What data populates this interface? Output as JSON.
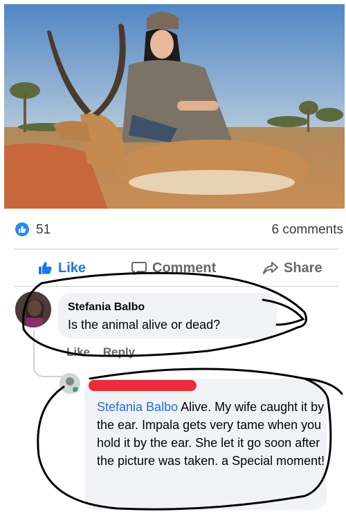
{
  "post": {
    "reaction_count": "51",
    "comment_count": "6 comments"
  },
  "actions": {
    "like": "Like",
    "comment": "Comment",
    "share": "Share"
  },
  "comments": [
    {
      "author": "Stefania Balbo",
      "text": "Is the animal alive or dead?",
      "like": "Like",
      "reply": "Reply"
    },
    {
      "author": "",
      "tag": "Stefania Balbo",
      "text": " Alive. My wife caught it by the ear. Impala gets very tame when you hold it by the ear. She let it go soon after the picture was taken. a Special moment!"
    }
  ],
  "colors": {
    "accent": "#1f8bf5",
    "tag": "#216fdb",
    "redaction": "#f02a3a",
    "bubble": "#f0f2f5",
    "scribble": "#000000"
  }
}
